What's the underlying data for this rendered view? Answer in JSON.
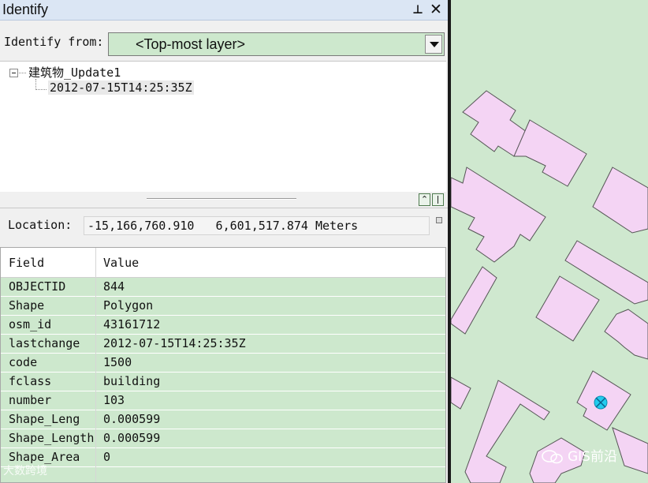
{
  "window": {
    "title": "Identify"
  },
  "identify_from": {
    "label": "Identify from:",
    "value": "<Top-most layer>"
  },
  "tree": {
    "layer": "建筑物_Update1",
    "feature": "2012-07-15T14:25:35Z"
  },
  "location": {
    "label": "Location:",
    "value": "-15,166,760.910   6,601,517.874 Meters"
  },
  "grid": {
    "headers": {
      "field": "Field",
      "value": "Value"
    },
    "rows": [
      {
        "field": "OBJECTID",
        "value": "844"
      },
      {
        "field": "Shape",
        "value": "Polygon"
      },
      {
        "field": "osm_id",
        "value": "43161712"
      },
      {
        "field": "lastchange",
        "value": "2012-07-15T14:25:35Z"
      },
      {
        "field": "code",
        "value": "1500"
      },
      {
        "field": "fclass",
        "value": "building"
      },
      {
        "field": "number",
        "value": "103"
      },
      {
        "field": "Shape_Leng",
        "value": "0.000599"
      },
      {
        "field": "Shape_Length",
        "value": "0.000599"
      },
      {
        "field": "Shape_Area",
        "value": "0"
      }
    ]
  },
  "watermarks": {
    "left": "大数跨境",
    "right": "GIS前沿"
  },
  "colors": {
    "row_green": "#cde8cd",
    "map_bg": "#cfe8cf",
    "building_fill": "#f4d4f4",
    "building_stroke": "#555555",
    "selection": "#22ccee"
  },
  "icons": [
    "pin-icon",
    "close-icon",
    "chevron-down-icon",
    "collapse-icon",
    "expand-icon",
    "bar-icon",
    "location-menu-icon",
    "selection-marker-icon",
    "wechat-icon"
  ]
}
